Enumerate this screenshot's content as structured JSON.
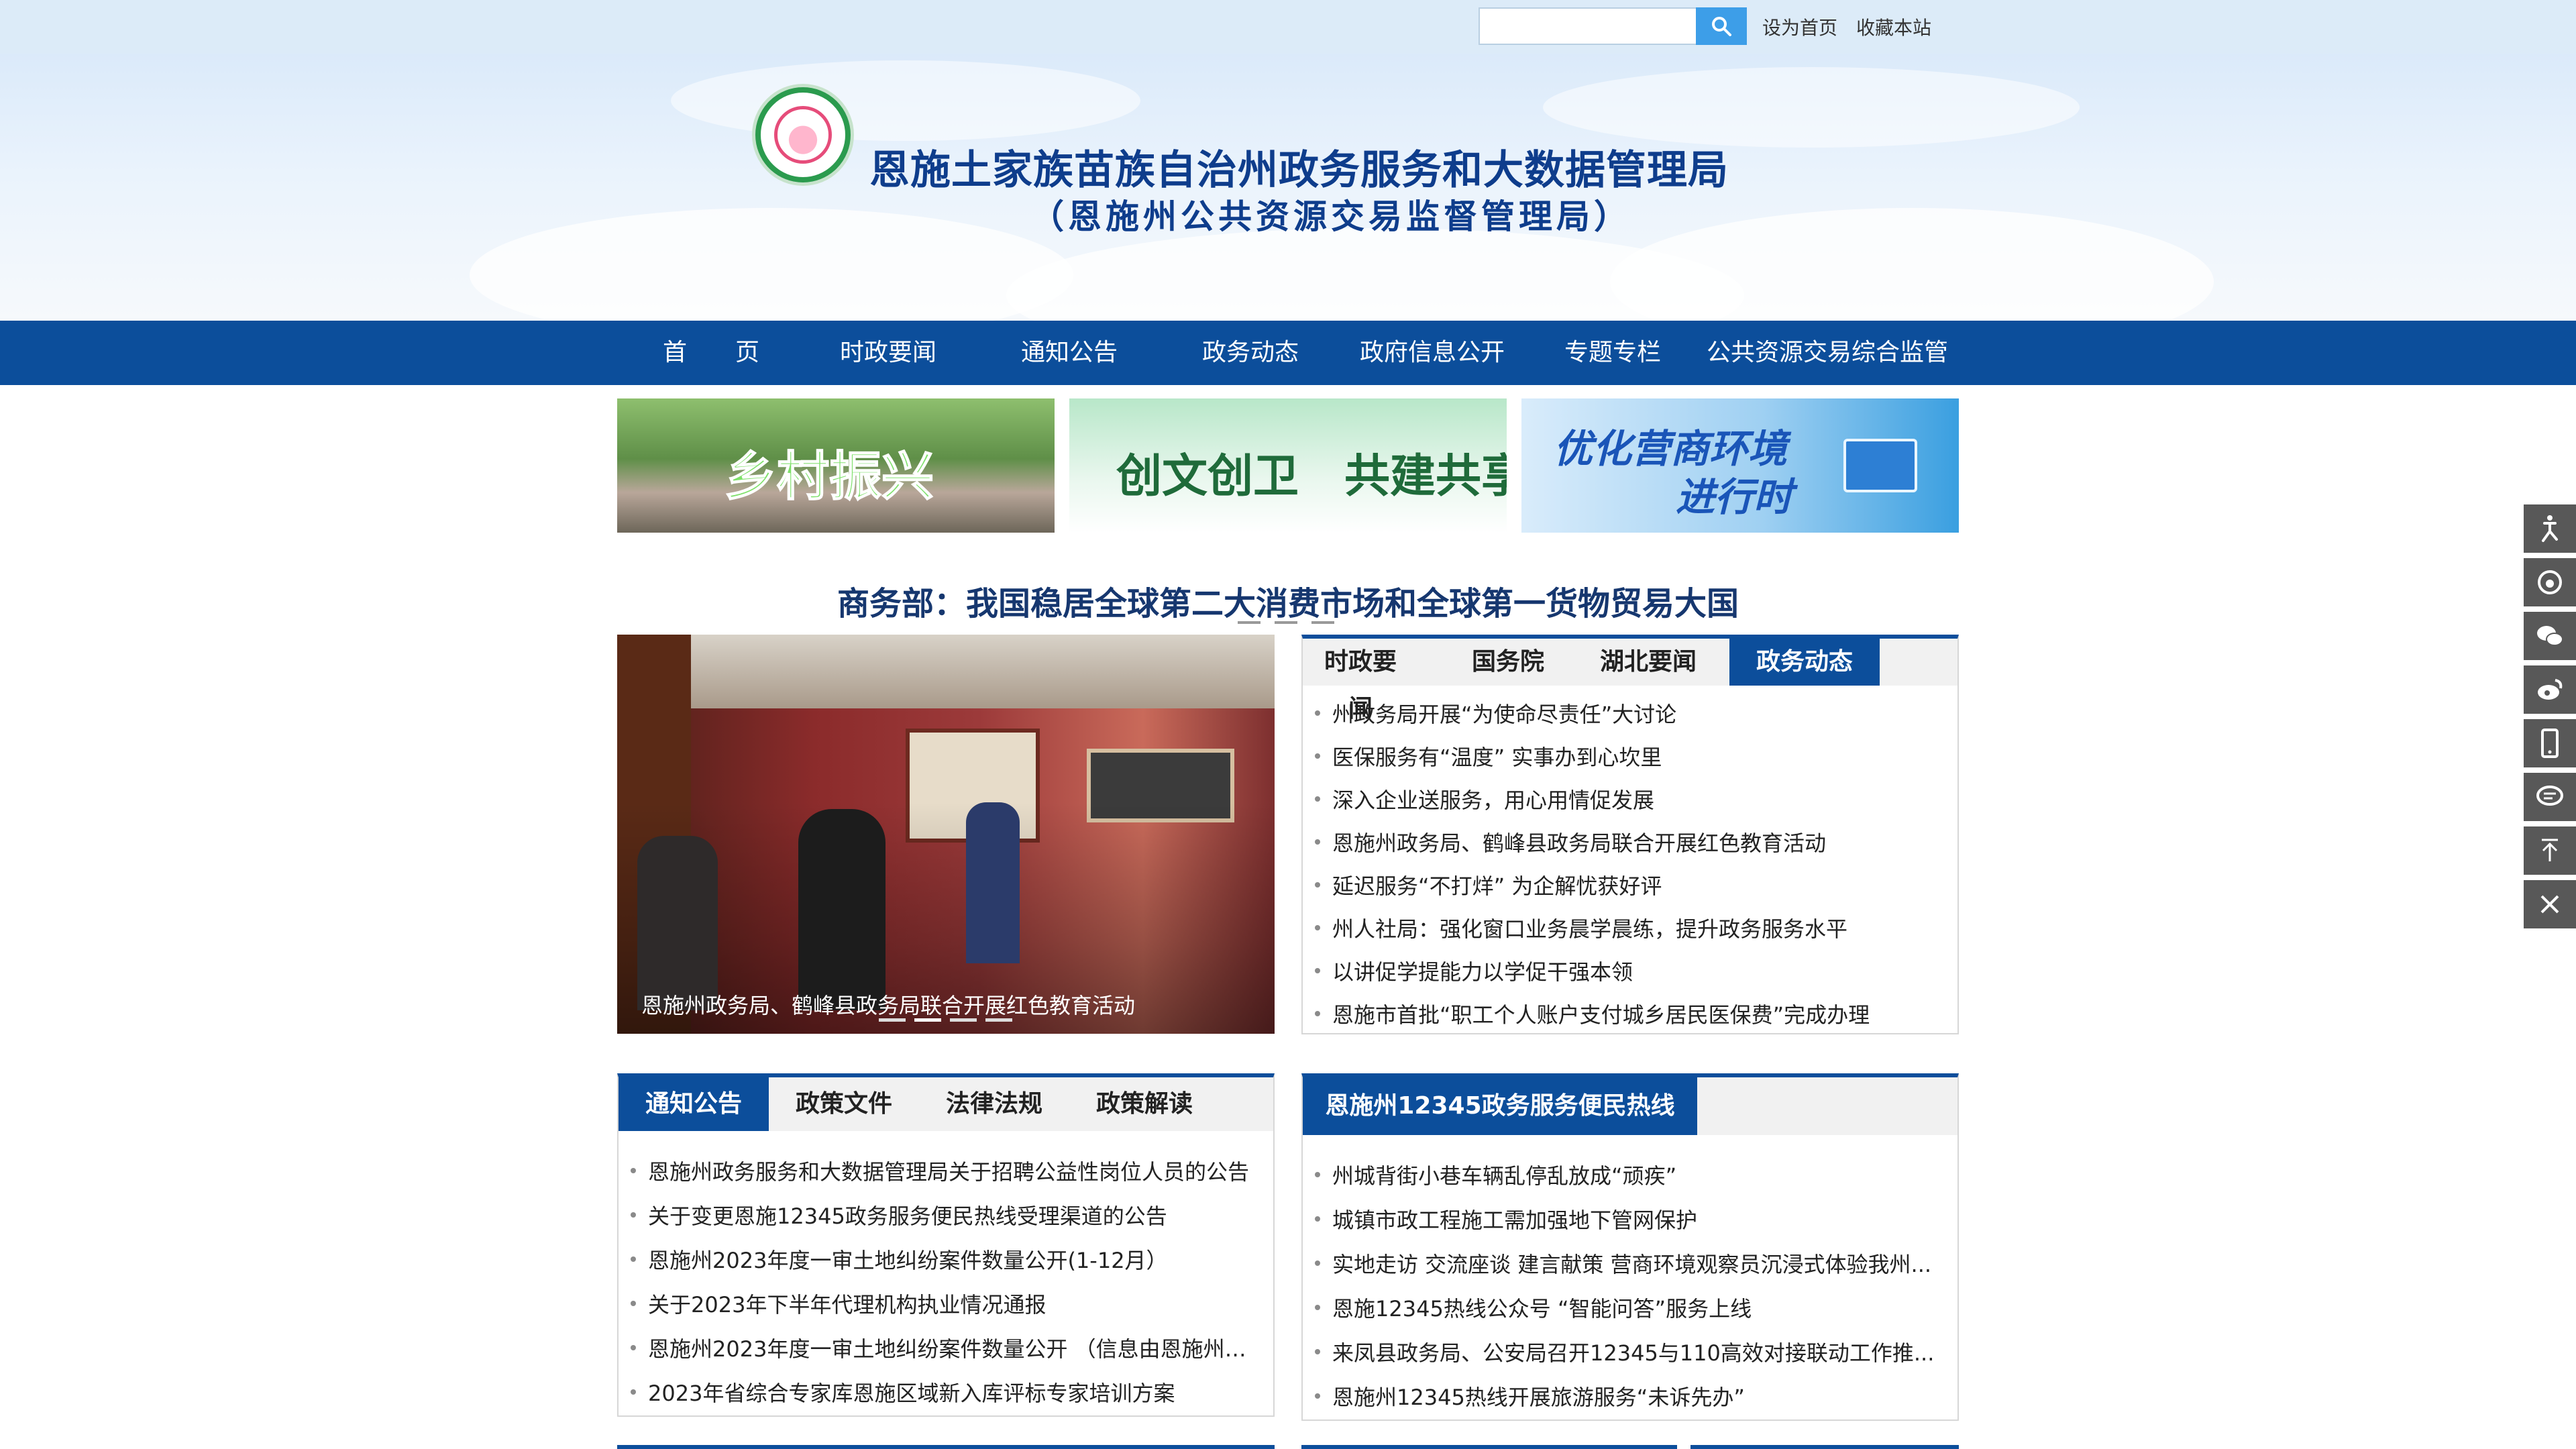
{
  "topbar": {
    "search_placeholder": "",
    "set_home": "设为首页",
    "bookmark": "收藏本站"
  },
  "header": {
    "title_main": "恩施土家族苗族自治州政务服务和大数据管理局",
    "title_sub": "（恩施州公共资源交易监督管理局）"
  },
  "nav": {
    "items": [
      "首　　页",
      "时政要闻",
      "通知公告",
      "政务动态",
      "政府信息公开",
      "专题专栏",
      "公共资源交易综合监管"
    ]
  },
  "promos": {
    "p1": "乡村振兴",
    "p2": "创文创卫　共建共享",
    "p3_line1": "优化营商环境",
    "p3_line2": "进行时"
  },
  "headline": "商务部：我国稳居全球第二大消费市场和全球第一货物贸易大国",
  "slider": {
    "caption": "恩施州政务局、鹤峰县政务局联合开展红色教育活动"
  },
  "news_panel": {
    "tabs": [
      "时政要闻",
      "国务院",
      "湖北要闻",
      "政务动态"
    ],
    "items": [
      "州政务局开展“为使命尽责任”大讨论",
      "医保服务有“温度” 实事办到心坎里",
      "深入企业送服务，用心用情促发展",
      "恩施州政务局、鹤峰县政务局联合开展红色教育活动",
      "延迟服务“不打烊” 为企解忧获好评",
      "州人社局：强化窗口业务晨学晨练，提升政务服务水平",
      "以讲促学提能力以学促干强本领",
      "恩施市首批“职工个人账户支付城乡居民医保费”完成办理"
    ]
  },
  "notice_panel": {
    "tabs": [
      "通知公告",
      "政策文件",
      "法律法规",
      "政策解读"
    ],
    "items": [
      "恩施州政务服务和大数据管理局关于招聘公益性岗位人员的公告",
      "关于变更恩施12345政务服务便民热线受理渠道的公告",
      "恩施州2023年度一审土地纠纷案件数量公开(1-12月）",
      "关于2023年下半年代理机构执业情况通报",
      "恩施州2023年度一审土地纠纷案件数量公开 （信息由恩施州中...",
      "2023年省综合专家库恩施区域新入库评标专家培训方案"
    ]
  },
  "hotline_panel": {
    "tab": "恩施州12345政务服务便民热线",
    "items": [
      "州城背街小巷车辆乱停乱放成“顽疾”",
      "城镇市政工程施工需加强地下管网保护",
      "实地走访 交流座谈 建言献策 营商环境观察员沉浸式体验我州...",
      "恩施12345热线公众号 “智能问答”服务上线",
      "来凤县政务局、公安局召开12345与110高效对接联动工作推...",
      "恩施州12345热线开展旅游服务“未诉先办”"
    ]
  },
  "side_tools": [
    "accessibility-icon",
    "weibo-round-icon",
    "wechat-icon",
    "weibo-icon",
    "mobile-icon",
    "message-icon",
    "back-to-top-icon",
    "close-icon"
  ],
  "colors": {
    "nav_blue": "#0c4e9b",
    "title_blue": "#0e3d8c",
    "search_blue": "#3d9ee8",
    "side_gray": "#585858"
  }
}
